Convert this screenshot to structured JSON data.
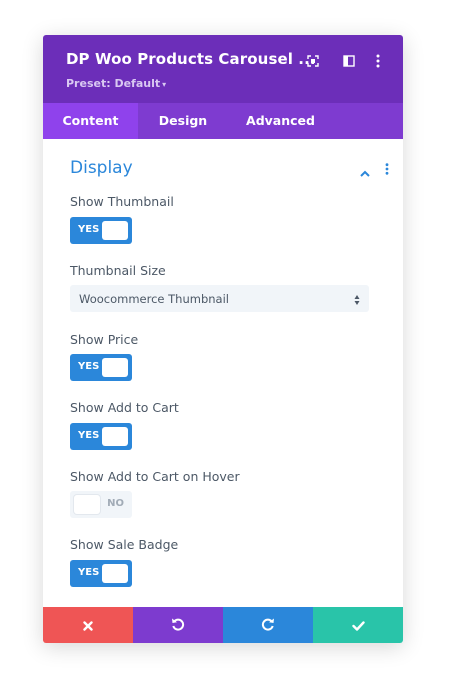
{
  "header": {
    "title": "DP Woo Products Carousel ...",
    "preset": "Preset: Default",
    "icons": [
      "expand-icon",
      "split-view-icon",
      "more-options-icon"
    ]
  },
  "tabs": [
    {
      "label": "Content",
      "active": true
    },
    {
      "label": "Design",
      "active": false
    },
    {
      "label": "Advanced",
      "active": false
    }
  ],
  "section": {
    "title": "Display",
    "icons": [
      "chevron-up-icon",
      "more-options-icon"
    ]
  },
  "fields": {
    "show_thumbnail": {
      "label": "Show Thumbnail",
      "toggle": "YES"
    },
    "thumbnail_size": {
      "label": "Thumbnail Size",
      "value": "Woocommerce Thumbnail"
    },
    "show_price": {
      "label": "Show Price",
      "toggle": "YES"
    },
    "show_add_to_cart": {
      "label": "Show Add to Cart",
      "toggle": "YES"
    },
    "show_add_to_cart_hover": {
      "label": "Show Add to Cart on Hover",
      "toggle": "NO"
    },
    "show_sale_badge": {
      "label": "Show Sale Badge",
      "toggle": "YES"
    }
  },
  "footer": {
    "buttons": [
      "close-icon",
      "undo-icon",
      "redo-icon",
      "check-icon"
    ],
    "colors": [
      "#ef5555",
      "#7d3bcf",
      "#2b87da",
      "#29c4a9"
    ]
  },
  "colors": {
    "header": "#6c2eb9",
    "tabs": "#7e3bd0",
    "active_tab": "#8f42ec",
    "accent": "#2b87da"
  }
}
